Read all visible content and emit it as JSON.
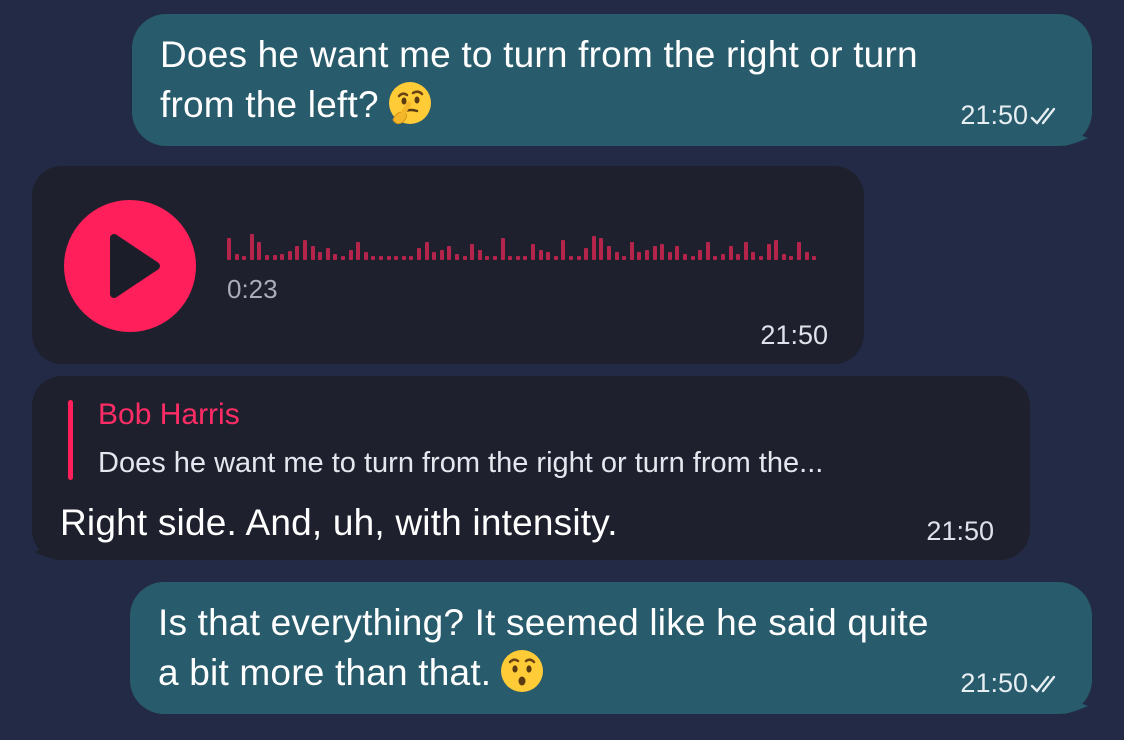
{
  "messages": [
    {
      "type": "outgoing_text",
      "line1": "Does he want me to turn from the right or turn",
      "line2": "from the left?",
      "emoji": "🤔",
      "emoji_name": "thinking-face",
      "time": "21:50",
      "status_icon": "double-check-icon"
    },
    {
      "type": "incoming_voice",
      "duration": "0:23",
      "time": "21:50",
      "play_icon": "play-icon"
    },
    {
      "type": "incoming_reply",
      "reply_author": "Bob Harris",
      "reply_preview": "Does he want me to turn from the right or turn from the...",
      "text": "Right side. And, uh, with intensity.",
      "time": "21:50"
    },
    {
      "type": "outgoing_text",
      "line1": "Is that everything? It seemed like he said quite",
      "line2": "a bit more than that.",
      "emoji": "😯",
      "emoji_name": "hushed-face",
      "time": "21:50",
      "status_icon": "double-check-icon"
    }
  ],
  "colors": {
    "background": "#222a45",
    "outgoing_bubble": "#285b6b",
    "incoming_bubble": "#1e212d",
    "accent": "#ff1f5a",
    "waveform": "#b5244b"
  }
}
